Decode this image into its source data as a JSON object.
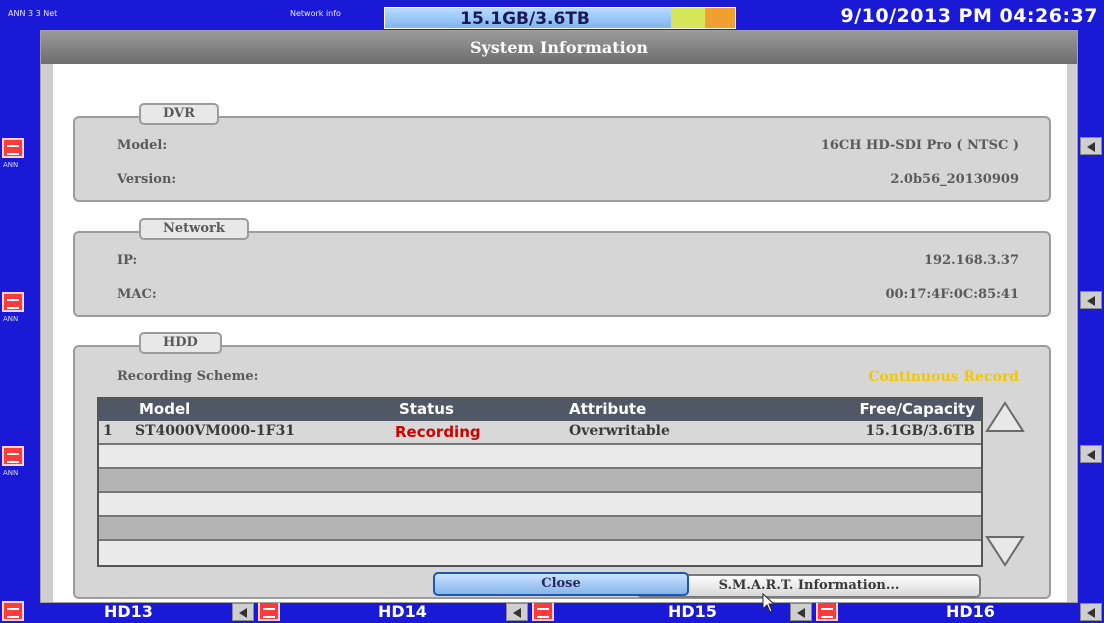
{
  "topbar": {
    "left_label_1": "ANN 3 3 Net",
    "left_label_2": "Network info",
    "storage_text": "15.1GB/3.6TB",
    "datetime": "9/10/2013 PM 04:26:37",
    "colors": {
      "bar_fill": "#8fc3f5",
      "seg_green": "#d6e85a",
      "seg_orange": "#f0a030"
    }
  },
  "side": {
    "channel_label": "ANN"
  },
  "bottom": {
    "channels": [
      "HD13",
      "HD14",
      "HD15",
      "HD16"
    ]
  },
  "dialog": {
    "title": "System Information",
    "dvr": {
      "tab": "DVR",
      "model_label": "Model:",
      "model_value": "16CH HD-SDI Pro ( NTSC )",
      "version_label": "Version:",
      "version_value": "2.0b56_20130909"
    },
    "network": {
      "tab": "Network",
      "ip_label": "IP:",
      "ip_value": "192.168.3.37",
      "mac_label": "MAC:",
      "mac_value": "00:17:4F:0C:85:41"
    },
    "hdd": {
      "tab": "HDD",
      "scheme_label": "Recording Scheme:",
      "scheme_value": "Continuous Record",
      "columns": [
        "Model",
        "Status",
        "Attribute",
        "Free/Capacity"
      ],
      "rows": [
        {
          "index": "1",
          "model": "ST4000VM000-1F31",
          "status": "Recording",
          "attribute": "Overwritable",
          "capacity": "15.1GB/3.6TB"
        }
      ],
      "smart_button": "S.M.A.R.T. Information...",
      "status_color": "#d00000",
      "scheme_color": "#f0c800"
    },
    "close_button": "Close"
  }
}
